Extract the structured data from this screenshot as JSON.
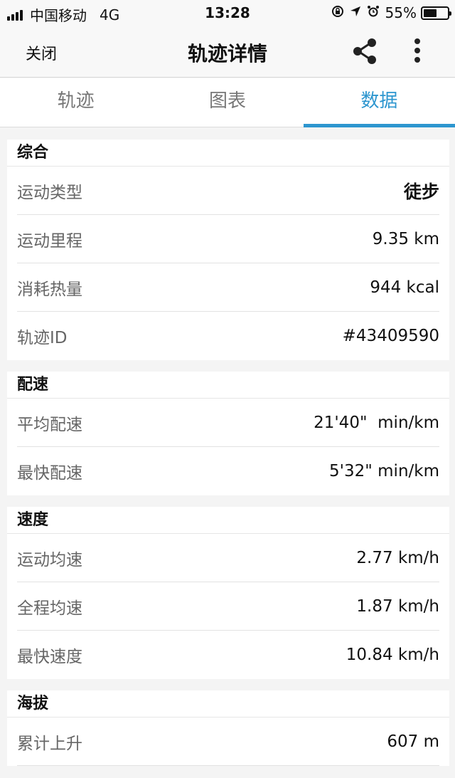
{
  "status": {
    "carrier": "中国移动",
    "network": "4G",
    "time": "13:28",
    "battery": "55%",
    "battery_level": 0.55
  },
  "nav": {
    "close_label": "关闭",
    "title": "轨迹详情"
  },
  "tabs": [
    {
      "label": "轨迹"
    },
    {
      "label": "图表"
    },
    {
      "label": "数据"
    }
  ],
  "active_tab": 2,
  "accent_color": "#2d96cf",
  "sections": {
    "summary": {
      "title": "综合",
      "rows": [
        {
          "label": "运动类型",
          "value": "徒步"
        },
        {
          "label": "运动里程",
          "value": "9.35 km"
        },
        {
          "label": "消耗热量",
          "value": "944 kcal"
        },
        {
          "label": "轨迹ID",
          "value": "#43409590"
        }
      ]
    },
    "pace": {
      "title": "配速",
      "rows": [
        {
          "label": "平均配速",
          "value": "21'40\"  min/km"
        },
        {
          "label": "最快配速",
          "value": "5'32\" min/km"
        }
      ]
    },
    "speed": {
      "title": "速度",
      "rows": [
        {
          "label": "运动均速",
          "value": "2.77 km/h"
        },
        {
          "label": "全程均速",
          "value": "1.87 km/h"
        },
        {
          "label": "最快速度",
          "value": "10.84 km/h"
        }
      ]
    },
    "altitude": {
      "title": "海拔",
      "rows": [
        {
          "label": "累计上升",
          "value": "607 m"
        }
      ]
    }
  },
  "icons": {
    "share": "share-icon",
    "more": "more-vertical-icon",
    "location": "location-arrow-icon",
    "alarm": "alarm-icon",
    "lock": "rotation-lock-icon"
  }
}
